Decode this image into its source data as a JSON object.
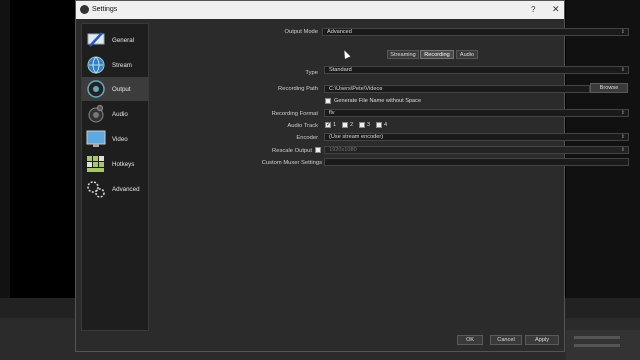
{
  "window": {
    "title": "Settings",
    "help_glyph": "?",
    "close_glyph": "✕"
  },
  "sidebar": {
    "items": [
      {
        "label": "General",
        "icon": "gear-monitor-icon"
      },
      {
        "label": "Stream",
        "icon": "globe-icon"
      },
      {
        "label": "Output",
        "icon": "output-icon"
      },
      {
        "label": "Audio",
        "icon": "speaker-icon"
      },
      {
        "label": "Video",
        "icon": "monitor-icon"
      },
      {
        "label": "Hotkeys",
        "icon": "keyboard-icon"
      },
      {
        "label": "Advanced",
        "icon": "gears-icon"
      }
    ],
    "active": "Output"
  },
  "output_mode": {
    "label": "Output Mode",
    "value": "Advanced"
  },
  "tabs": [
    {
      "label": "Streaming"
    },
    {
      "label": "Recording"
    },
    {
      "label": "Audio"
    }
  ],
  "active_tab": "Recording",
  "type": {
    "label": "Type",
    "value": "Standard"
  },
  "recording_path": {
    "label": "Recording Path",
    "value": "C:\\Users\\Pete\\Videos",
    "browse_label": "Browse"
  },
  "generate_filename": {
    "label": "Generate File Name without Space",
    "checked": false
  },
  "recording_format": {
    "label": "Recording Format",
    "value": "flv"
  },
  "audio_track": {
    "label": "Audio Track",
    "tracks": [
      {
        "label": "1",
        "checked": true
      },
      {
        "label": "2",
        "checked": false
      },
      {
        "label": "3",
        "checked": false
      },
      {
        "label": "4",
        "checked": false
      }
    ]
  },
  "encoder": {
    "label": "Encoder",
    "value": "(Use stream encoder)"
  },
  "rescale_output": {
    "label": "Rescale Output",
    "checked": false,
    "value": "1920x1080"
  },
  "custom_muxer": {
    "label": "Custom Muxer Settings",
    "value": ""
  },
  "footer": {
    "ok": "OK",
    "cancel": "Cancel",
    "apply": "Apply"
  }
}
